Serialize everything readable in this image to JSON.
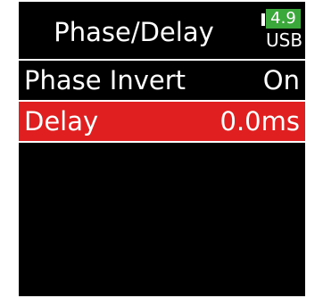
{
  "header": {
    "title": "Phase/Delay"
  },
  "status": {
    "battery_voltage": "4.9",
    "power_source": "USB",
    "battery_color": "#3aa83a"
  },
  "menu": {
    "items": [
      {
        "label": "Phase Invert",
        "value": "On",
        "selected": false
      },
      {
        "label": "Delay",
        "value": "0.0ms",
        "selected": true
      }
    ],
    "selection_color": "#e02020"
  }
}
